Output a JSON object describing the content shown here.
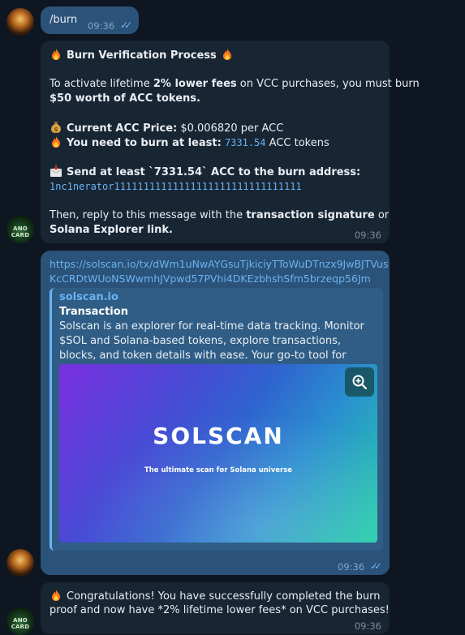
{
  "messages": {
    "burn_command": {
      "text": "/burn",
      "time": "09:36"
    },
    "burn_process": {
      "title": "Burn Verification Process",
      "p1_a": "To activate lifetime ",
      "p1_b": "2% lower fees",
      "p1_c": " on VCC purchases, you must burn",
      "p1_d": "$50 worth of ACC tokens.",
      "price_label": "Current ACC Price:",
      "price_value": " $0.006820 per ACC",
      "need_label": "You need to burn at least:",
      "need_value": "7331.54",
      "need_suffix": " ACC tokens",
      "send_label": "Send at least `7331.54` ACC to the burn address:",
      "address": "1nc1nerator11111111111111111111111111111111",
      "reply_a": "Then, reply to this message with the ",
      "reply_b": "transaction signature",
      "reply_c": " or",
      "reply_d": "Solana Explorer link.",
      "time": "09:36"
    },
    "link_message": {
      "url_line1": "https://solscan.io/tx/dWm1uNwAYGsuTjkiciyTToWuDTnzx9JwBJTVus",
      "url_line2": "KcCRDtWUoNSWwmhJVpwd57PVhi4DKEzbhshSfm5brzeqp56Jm",
      "preview_site": "solscan.io",
      "preview_title": "Transaction",
      "preview_desc": "Solscan is an explorer for real-time data tracking. Monitor $SOL and Solana-based tokens, explore transactions, blocks, and token details with ease. Your go-to tool for seamless insights into the S...",
      "image_logo": "SOLSCAN",
      "image_tagline": "The ultimate scan for Solana universe",
      "time": "09:36"
    },
    "congrats": {
      "line1": "Congratulations! You have successfully completed the burn",
      "line2": "proof and now have *2% lifetime lower fees* on VCC purchases!",
      "time": "09:36"
    }
  },
  "avatars": {
    "bot_label": "ANO CARD"
  },
  "colors": {
    "background": "#0e1621",
    "outgoing": "#2b5278",
    "incoming": "#182533",
    "link": "#6ab3f3"
  },
  "icons": {
    "fire": "fire-icon",
    "money_bag": "money-bag-icon",
    "envelope": "incoming-envelope-icon",
    "zoom": "zoom-in-icon",
    "read_ticks": "double-check-icon"
  }
}
